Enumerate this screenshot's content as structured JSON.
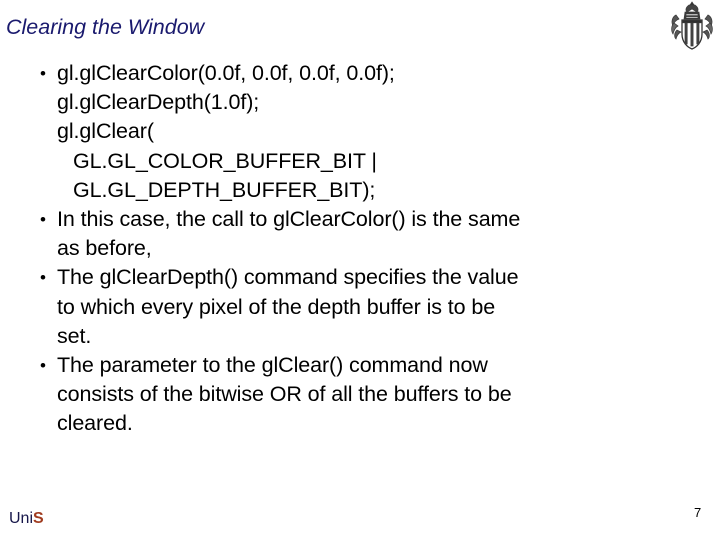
{
  "slide": {
    "title": "Clearing the Window",
    "page_number": "7",
    "logo": {
      "text_primary": "Uni",
      "text_accent": "S",
      "crest_name": "university-crest"
    },
    "colors": {
      "title": "#1a1a6e",
      "body": "#000000",
      "background": "#ffffff",
      "logo_primary": "#17174a",
      "logo_accent": "#a03c20"
    },
    "bullets": [
      {
        "marker": "•",
        "lines": [
          {
            "text": "gl.glClearColor(0.0f, 0.0f, 0.0f, 0.0f);",
            "indent": 0
          },
          {
            "text": "gl.glClearDepth(1.0f);",
            "indent": 0
          },
          {
            "text": "gl.glClear(",
            "indent": 0
          },
          {
            "text": "GL.GL_COLOR_BUFFER_BIT |",
            "indent": 1
          },
          {
            "text": "GL.GL_DEPTH_BUFFER_BIT);",
            "indent": 1
          }
        ]
      },
      {
        "marker": "•",
        "lines": [
          {
            "text": "In this case, the call to glClearColor() is the same",
            "indent": 0
          },
          {
            "text": "as before,",
            "indent": 0
          }
        ]
      },
      {
        "marker": "•",
        "lines": [
          {
            "text": "The glClearDepth() command specifies the value",
            "indent": 0
          },
          {
            "text": "to which every pixel of the depth buffer is to be",
            "indent": 0
          },
          {
            "text": "set.",
            "indent": 0
          }
        ]
      },
      {
        "marker": "•",
        "lines": [
          {
            "text": "The parameter to the glClear() command now",
            "indent": 0
          },
          {
            "text": "consists of the bitwise OR of all the buffers to be",
            "indent": 0
          },
          {
            "text": "cleared.",
            "indent": 0
          }
        ]
      }
    ]
  }
}
